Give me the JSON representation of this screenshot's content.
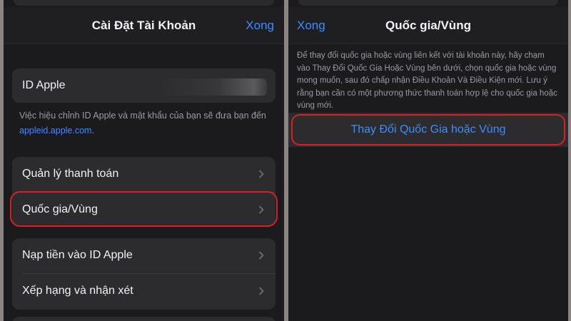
{
  "left_screen": {
    "nav": {
      "title": "Cài Đặt Tài Khoản",
      "done": "Xong"
    },
    "apple_id": {
      "label": "ID Apple",
      "note_prefix": "Việc hiệu chỉnh ID Apple và mật khẩu của bạn sẽ đưa bạn đến ",
      "note_link": "appleid.apple.com",
      "note_suffix": "."
    },
    "group1": [
      {
        "label": "Quản lý thanh toán"
      },
      {
        "label": "Quốc gia/Vùng"
      }
    ],
    "group2": [
      {
        "label": "Nạp tiền vào ID Apple"
      },
      {
        "label": "Xếp hạng và nhận xét"
      }
    ]
  },
  "right_screen": {
    "nav": {
      "back": "Xong",
      "title": "Quốc gia/Vùng"
    },
    "description": "Để thay đổi quốc gia hoặc vùng liên kết với tài khoản này, hãy chạm vào Thay Đổi Quốc Gia Hoặc Vùng bên dưới, chọn quốc gia hoặc vùng mong muốn, sau đó chấp nhận Điều Khoản Và Điều Kiện mới. Lưu ý rằng bạn cần có một phương thức thanh toán hợp lệ cho quốc gia hoặc vùng mới.",
    "change_button": "Thay Đổi Quốc Gia hoặc Vùng"
  },
  "colors": {
    "accent": "#3f8cff",
    "highlight": "#d6202a",
    "background": "#1b1b1d",
    "cell": "#2c2c2e"
  },
  "icons": [
    "chevron-right-icon"
  ]
}
